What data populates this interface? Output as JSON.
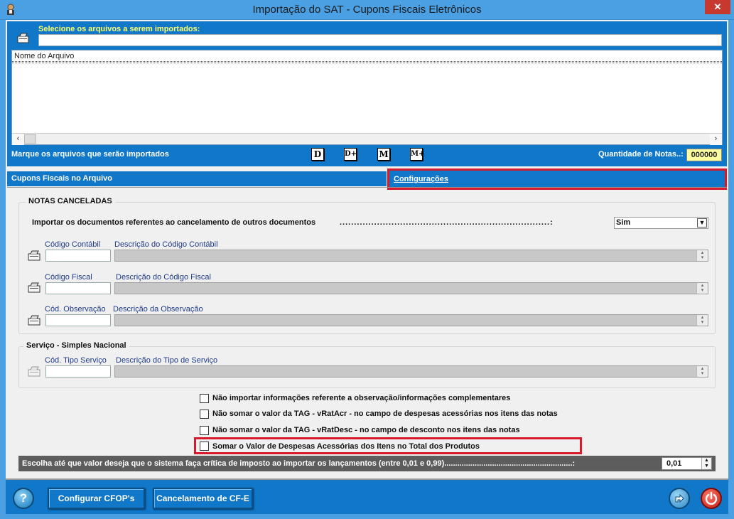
{
  "window": {
    "title": "Importação do SAT - Cupons Fiscais Eletrônicos",
    "close_glyph": "✕"
  },
  "import": {
    "select_label": "Selecione os arquivos a serem importados:",
    "file_path": "",
    "file_list": {
      "column_header": "Nome do Arquivo",
      "rows": []
    },
    "mark_label": "Marque os arquivos que serão importados",
    "mark_buttons": [
      "D",
      "D+",
      "M",
      "M+"
    ],
    "quantity_label": "Quantidade de Notas..:",
    "quantity_value": "000000"
  },
  "tabs": [
    {
      "label": "Cupons Fiscais no Arquivo",
      "active": false
    },
    {
      "label": "Configurações",
      "active": true
    }
  ],
  "notas_canceladas": {
    "title": "NOTAS CANCELADAS",
    "import_cancel_label": "Importar os documentos referentes ao cancelamento de outros documentos",
    "import_cancel_dots": ".........................................................................:",
    "import_cancel_value": "Sim",
    "fields": [
      {
        "code_label": "Código Contábil",
        "desc_label": "Descrição do Código Contábil",
        "code": "",
        "desc": ""
      },
      {
        "code_label": "Código Fiscal",
        "desc_label": "Descrição do Código Fiscal",
        "code": "",
        "desc": ""
      },
      {
        "code_label": "Cód. Observação",
        "desc_label": "Descrição da Observação",
        "code": "",
        "desc": ""
      }
    ]
  },
  "servico": {
    "title": "Serviço - Simples Nacional",
    "code_label": "Cód. Tipo Serviço",
    "desc_label": "Descrição do Tipo de Serviço",
    "code": "",
    "desc": ""
  },
  "options": [
    {
      "label": "Não importar informações referente a observação/informações complementares",
      "checked": false
    },
    {
      "label": "Não somar o valor da TAG - vRatAcr - no campo de despesas acessórias nos itens das notas",
      "checked": false
    },
    {
      "label": "Não somar o valor da TAG - vRatDesc - no campo de desconto nos itens das notas",
      "checked": false
    },
    {
      "label": "Somar o Valor de Despesas Acessórias dos Itens no Total dos Produtos",
      "checked": false
    }
  ],
  "critic": {
    "label": "Escolha até que valor deseja que o sistema faça crítica de imposto ao importar os lançamentos (entre 0,01 e 0,99)...........................................................:",
    "value": "0,01"
  },
  "bottom": {
    "help_glyph": "?",
    "btn_cfop": "Configurar CFOP's",
    "btn_cancel": "Cancelamento de CF-E"
  },
  "colors": {
    "accent_blue": "#1077c9",
    "highlight_red": "#d7192a",
    "title_blue": "#4aa0e2",
    "qty_yellow": "#ffffa0"
  }
}
